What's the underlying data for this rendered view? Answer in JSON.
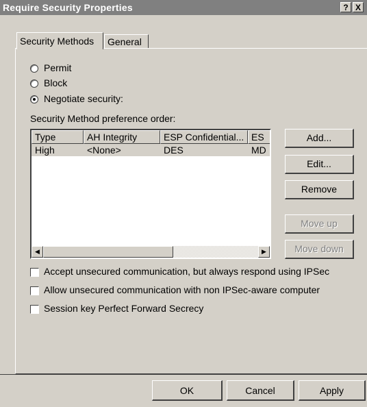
{
  "window": {
    "title": "Require Security Properties",
    "help_btn": "?",
    "close_btn": "X"
  },
  "tabs": [
    {
      "label": "Security Methods"
    },
    {
      "label": "General"
    }
  ],
  "radios": [
    {
      "label": "Permit",
      "selected": false
    },
    {
      "label": "Block",
      "selected": false
    },
    {
      "label": "Negotiate security:",
      "selected": true
    }
  ],
  "list": {
    "caption": "Security Method preference order:",
    "columns": [
      "Type",
      "AH Integrity",
      "ESP Confidential...",
      "ES"
    ],
    "rows": [
      {
        "type": "High",
        "ah": "<None>",
        "esp_conf": "DES",
        "es": "MD"
      }
    ]
  },
  "side_buttons": {
    "add": "Add...",
    "edit": "Edit...",
    "remove": "Remove",
    "move_up": "Move up",
    "move_down": "Move down"
  },
  "checkboxes": [
    {
      "label": "Accept unsecured communication, but always respond using IPSec",
      "checked": false
    },
    {
      "label": "Allow unsecured communication with non IPSec-aware computer",
      "checked": false
    },
    {
      "label": "Session key Perfect Forward Secrecy",
      "checked": false
    }
  ],
  "footer": {
    "ok": "OK",
    "cancel": "Cancel",
    "apply": "Apply"
  }
}
